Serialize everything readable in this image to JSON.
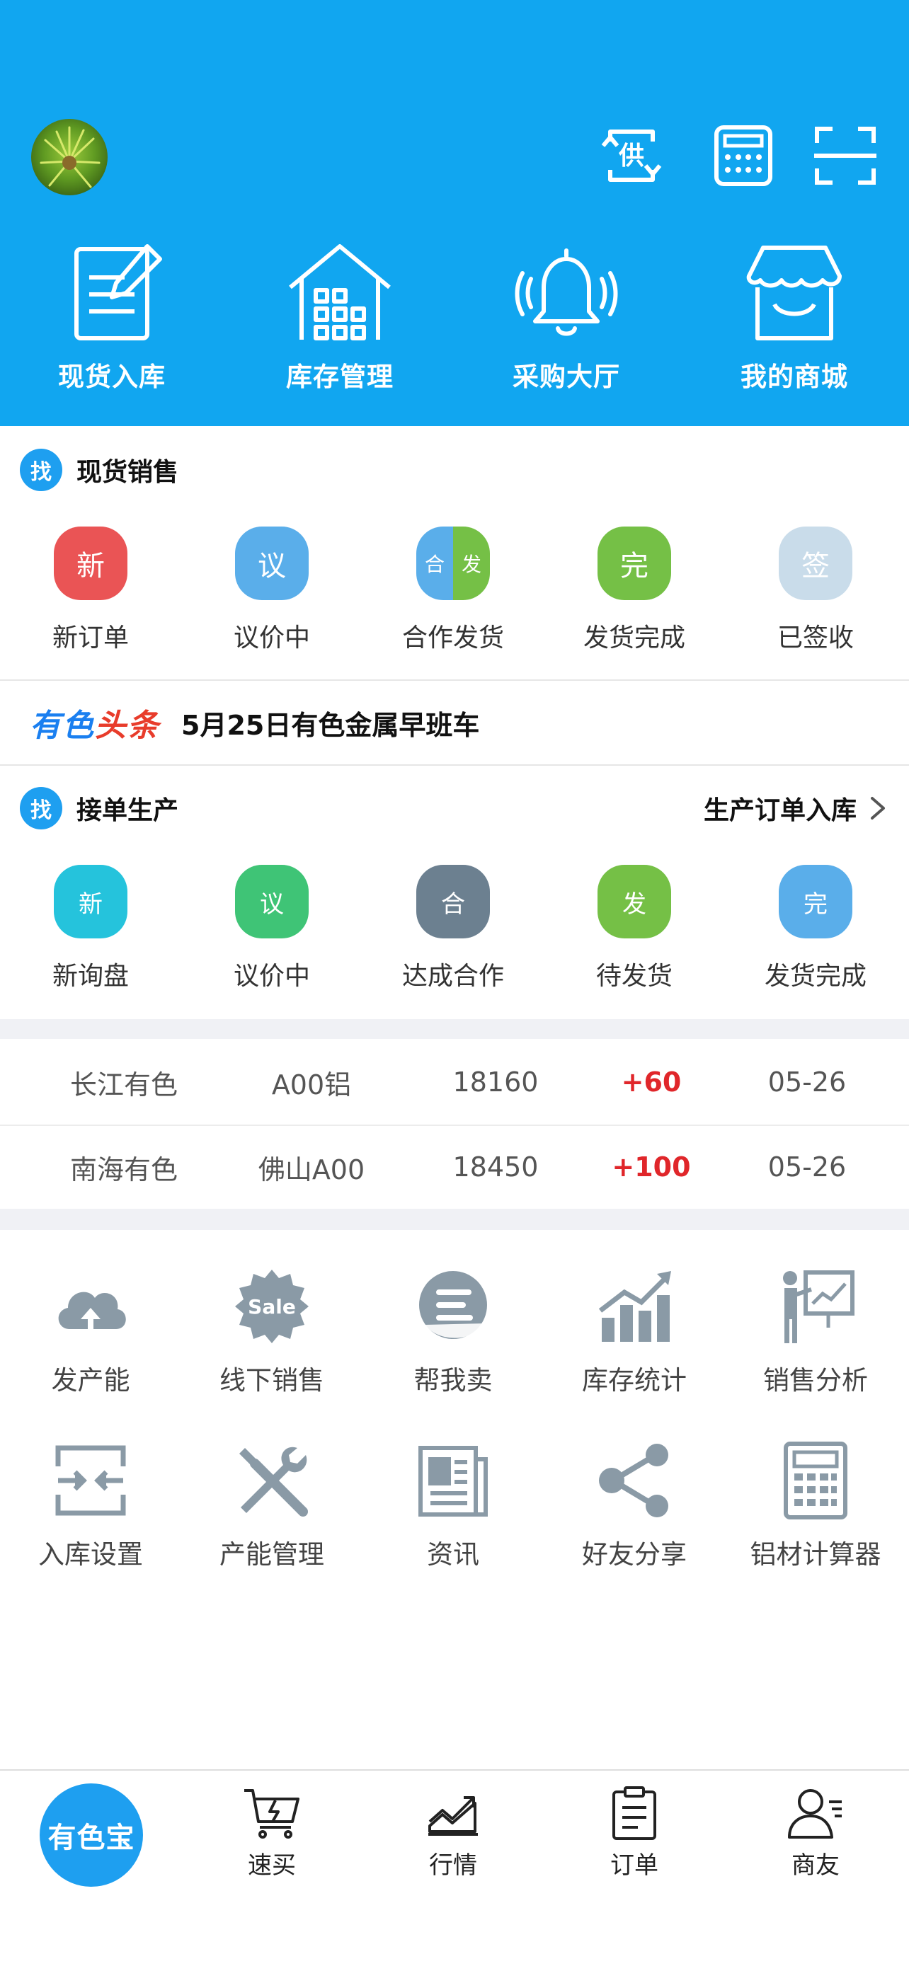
{
  "header": {
    "top_icons": [
      {
        "name": "supply-icon",
        "glyph": "供"
      },
      {
        "name": "calculator-icon"
      },
      {
        "name": "scan-icon"
      }
    ],
    "quick_actions": [
      {
        "label": "现货入库",
        "icon": "document-edit-icon"
      },
      {
        "label": "库存管理",
        "icon": "warehouse-icon"
      },
      {
        "label": "采购大厅",
        "icon": "bell-icon"
      },
      {
        "label": "我的商城",
        "icon": "store-icon"
      }
    ],
    "background": "#11a6f0"
  },
  "spot_sales": {
    "badge": "找",
    "title": "现货销售",
    "items": [
      {
        "icon_text": "新",
        "label": "新订单",
        "color": "#ea5455"
      },
      {
        "icon_text": "议",
        "label": "议价中",
        "color": "#5aaeea"
      },
      {
        "icon_text_left": "合",
        "icon_text_right": "发",
        "label": "合作发货",
        "color_left": "#5aaeea",
        "color_right": "#75c046"
      },
      {
        "icon_text": "完",
        "label": "发货完成",
        "color": "#75c046"
      },
      {
        "icon_text": "签",
        "label": "已签收",
        "color": "#c9dcea"
      }
    ]
  },
  "news": {
    "logo_part1": "有色",
    "logo_part2": "头条",
    "headline": "5月25日有色金属早班车"
  },
  "production": {
    "badge": "找",
    "title": "接单生产",
    "link": "生产订单入库",
    "items": [
      {
        "icon_text": "新",
        "label": "新询盘",
        "color": "#25c3dc"
      },
      {
        "icon_text": "议",
        "label": "议价中",
        "color": "#3fc476"
      },
      {
        "icon_text": "合",
        "label": "达成合作",
        "color": "#6c8090"
      },
      {
        "icon_text": "发",
        "label": "待发货",
        "color": "#75c046"
      },
      {
        "icon_text": "完",
        "label": "发货完成",
        "color": "#5aaeea"
      }
    ]
  },
  "prices": [
    {
      "market": "长江有色",
      "product": "A00铝",
      "price": "18160",
      "change": "+60",
      "date": "05-26"
    },
    {
      "market": "南海有色",
      "product": "佛山A00",
      "price": "18450",
      "change": "+100",
      "date": "05-26"
    }
  ],
  "tools": [
    {
      "label": "发产能",
      "icon": "cloud-upload-icon"
    },
    {
      "label": "线下销售",
      "icon": "sale-badge-icon",
      "icon_text": "Sale"
    },
    {
      "label": "帮我卖",
      "icon": "help-sell-icon"
    },
    {
      "label": "库存统计",
      "icon": "bar-chart-icon"
    },
    {
      "label": "销售分析",
      "icon": "presentation-icon"
    },
    {
      "label": "入库设置",
      "icon": "inbound-settings-icon"
    },
    {
      "label": "产能管理",
      "icon": "tools-icon"
    },
    {
      "label": "资讯",
      "icon": "newspaper-icon"
    },
    {
      "label": "好友分享",
      "icon": "share-icon"
    },
    {
      "label": "铝材计算器",
      "icon": "calculator-icon"
    }
  ],
  "tabbar": {
    "home": "有色宝",
    "tabs": [
      {
        "label": "速买",
        "icon": "fast-cart-icon"
      },
      {
        "label": "行情",
        "icon": "trend-icon"
      },
      {
        "label": "订单",
        "icon": "clipboard-icon"
      },
      {
        "label": "商友",
        "icon": "contacts-icon"
      }
    ]
  }
}
